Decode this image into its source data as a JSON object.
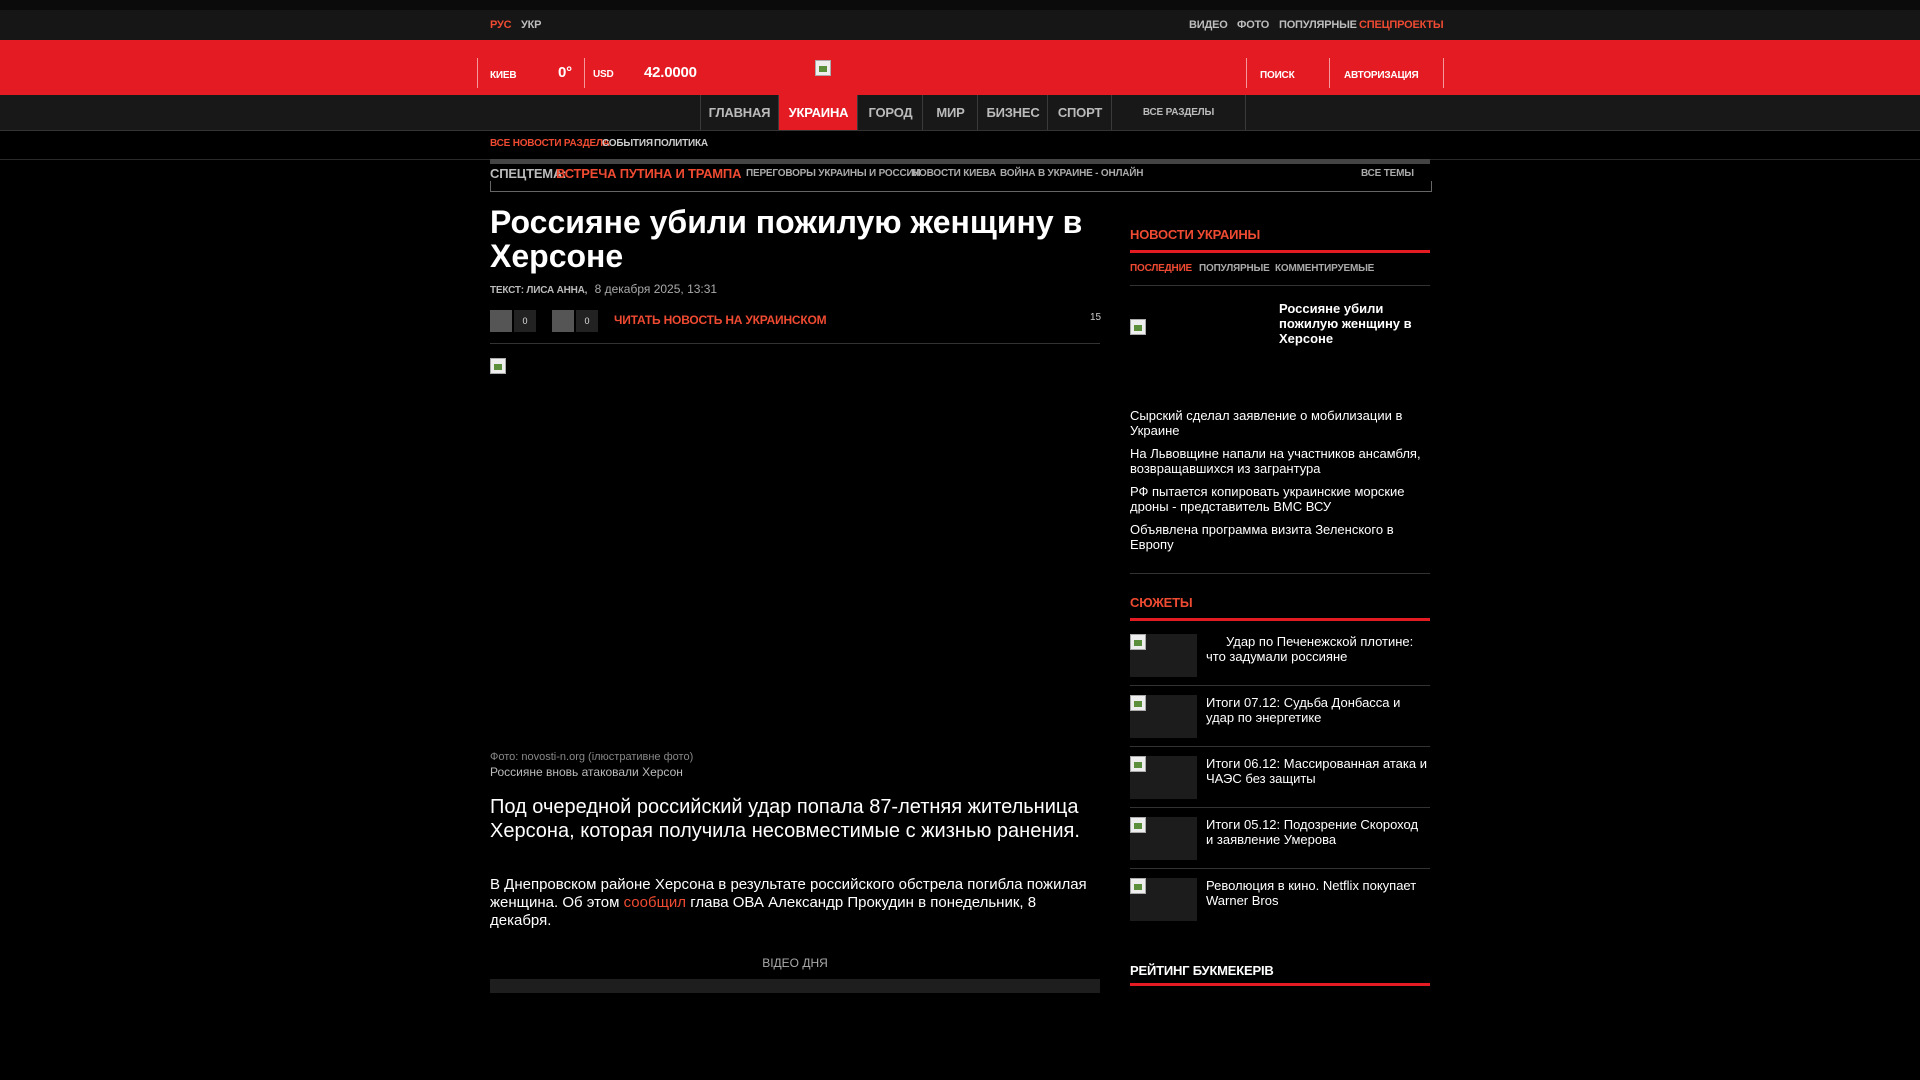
{
  "topbar": {
    "lang_ru": "РУС",
    "lang_ua": "УКР",
    "links": [
      "ВИДЕО",
      "ФОТО",
      "ПОПУЛЯРНЫЕ",
      "СПЕЦПРОЕКТЫ"
    ]
  },
  "header": {
    "city": "КИЕВ",
    "temperature": "0°",
    "currency": "USD",
    "rate": "42.0000",
    "search": "ПОИСК",
    "login": "АВТОРИЗАЦИЯ"
  },
  "nav": {
    "items": [
      "ГЛАВНАЯ",
      "УКРАИНА",
      "ГОРОД",
      "МИР",
      "БИЗНЕС",
      "СПОРТ",
      "ВСЕ РАЗДЕЛЫ"
    ]
  },
  "subnav": {
    "items": [
      "ВСЕ НОВОСТИ РАЗДЕЛА",
      "СОБЫТИЯ",
      "ПОЛИТИКА"
    ]
  },
  "spec": {
    "label": "СПЕЦТЕМА:",
    "topic": "ВСТРЕЧА ПУТИНА И ТРАМПА",
    "links": [
      "ПЕРЕГОВОРЫ УКРАИНЫ И РОССИИ",
      "НОВОСТИ КИЕВА",
      "ВОЙНА В УКРАИНЕ - ОНЛАЙН"
    ],
    "all": "ВСЕ ТЕМЫ"
  },
  "article": {
    "title": "Россияне убили пожилую женщину в Херсоне",
    "author": "ТЕКСТ: ЛИСА АННА,",
    "date": "8 декабря 2025, 13:31",
    "share1_count": "0",
    "share2_count": "0",
    "read_ukr": "ЧИТАТЬ НОВОСТЬ НА УКРАИНСКОМ",
    "comments": "15",
    "photo_credit": "Фото: novosti-n.org (ілюстративне фото)",
    "photo_caption": "Россияне вновь атаковали Херсон",
    "lead": "Под очередной российский удар попала 87-летняя жительница Херсона, которая получила несовместимые с жизнью ранения.",
    "body_1": "В Днепровском районе Херсона в результате российского обстрела погибла пожилая женщина. Об этом ",
    "body_link": "сообщил",
    "body_2": " глава ОВА Александр Прокудин в понедельник, 8 декабря.",
    "video_day": "ВІДЕО ДНЯ"
  },
  "sidebar": {
    "news_head": "НОВОСТИ УКРАИНЫ",
    "tabs": [
      "ПОСЛЕДНИЕ",
      "ПОПУЛЯРНЫЕ",
      "КОММЕНТИРУЕМЫЕ"
    ],
    "featured": "Россияне убили пожилую женщину в Херсоне",
    "news": [
      "Сырский сделал заявление о мобилизации в Украине",
      "На Львовщине напали на участников ансамбля, возвращавшихся из загрантура",
      "РФ пытается копировать украинские морские дроны - представитель ВМС ВСУ",
      "Объявлена программа визита Зеленского в Европу"
    ],
    "stories_head": "СЮЖЕТЫ",
    "stories": [
      "Удар по Печенежской плотине: что задумали россияне",
      "Итоги 07.12: Судьба Донбасса и удар по энергетике",
      "Итоги 06.12: Массированная атака и ЧАЭС без защиты",
      "Итоги 05.12: Подозрение Скороход и заявление Умерова",
      "Революция в кино. Netflix покупает Warner Bros"
    ],
    "bookmakers_head": "РЕЙТИНГ БУКМЕКЕРІВ"
  },
  "colors": {
    "accent": "#e51b23",
    "link": "#ef4a32",
    "background": "#000000"
  }
}
